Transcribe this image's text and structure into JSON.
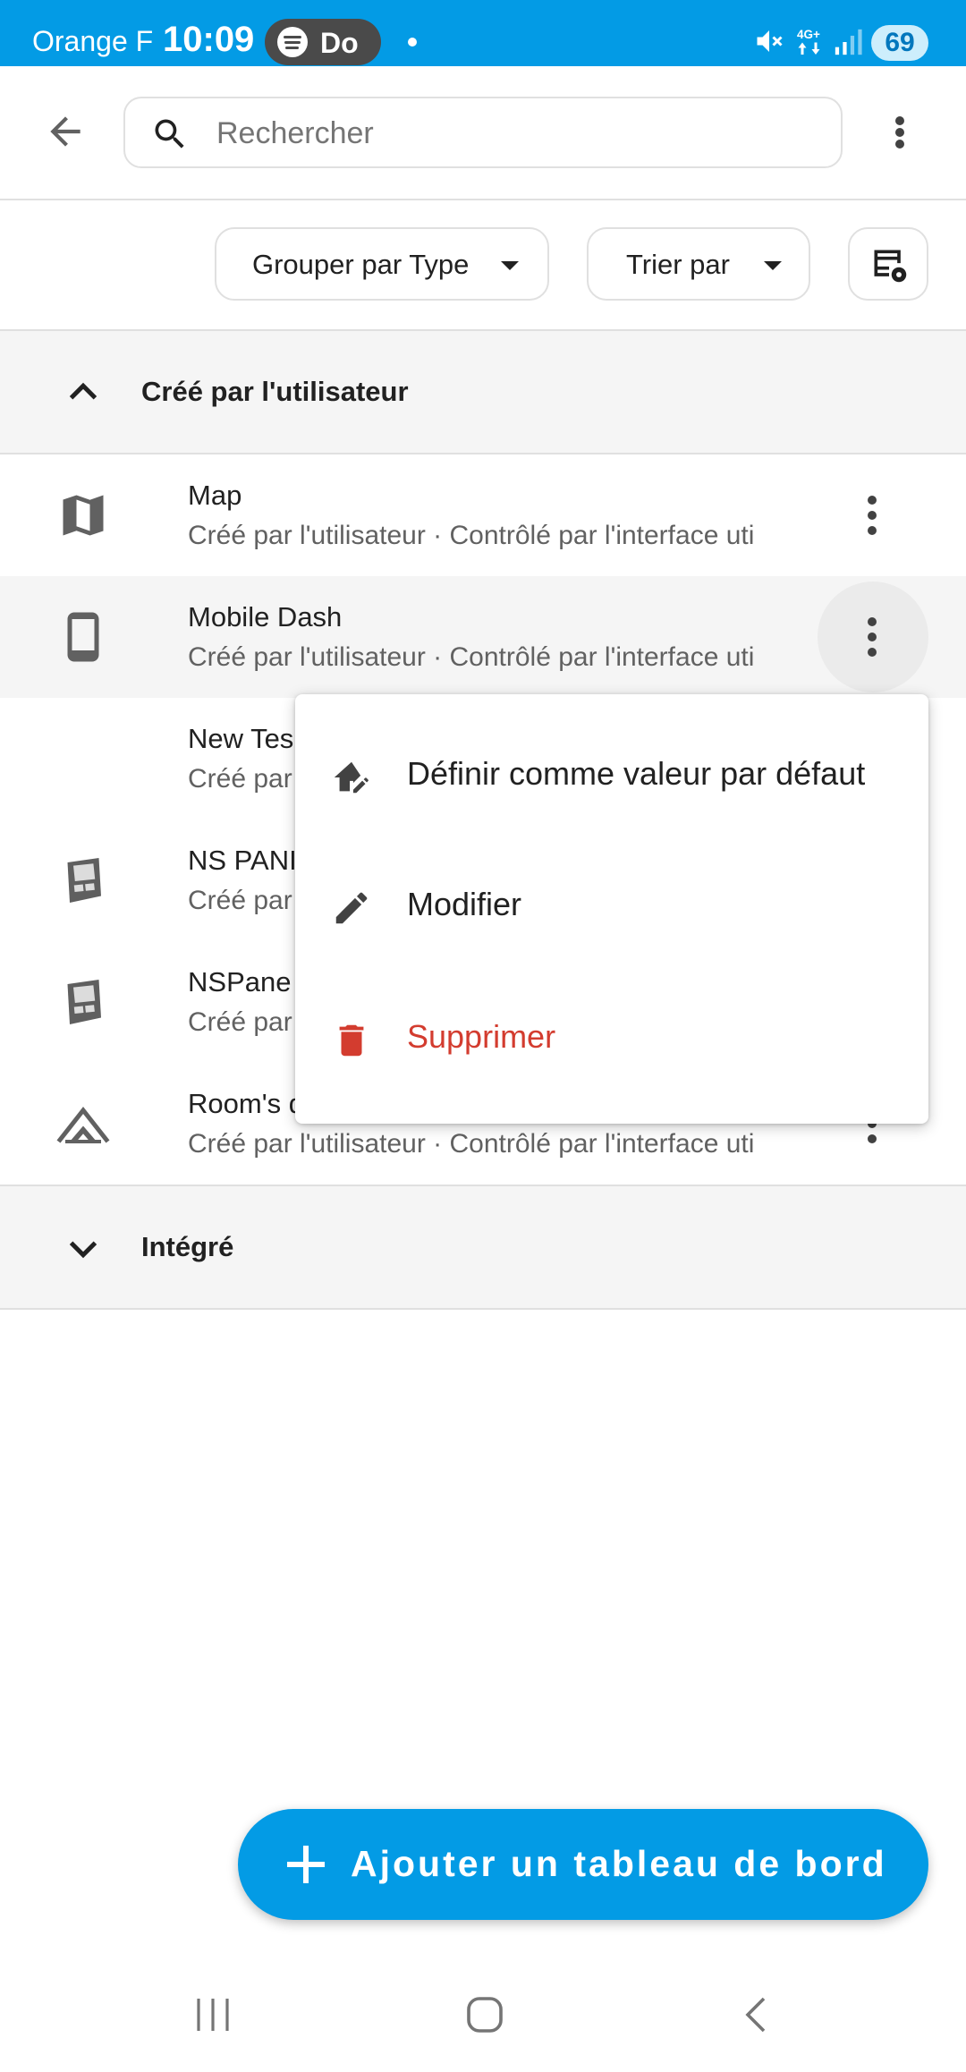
{
  "status_bar": {
    "carrier": "Orange F",
    "time": "10:09",
    "media_text": "Do",
    "battery": "69",
    "icons": [
      "spotify-icon",
      "mute-icon",
      "4g-icon",
      "signal-icon",
      "battery-icon"
    ]
  },
  "app_bar": {
    "search": {
      "placeholder": "Rechercher"
    },
    "icons": [
      "back-arrow-icon",
      "search-icon",
      "more-vert-icon"
    ]
  },
  "filters": {
    "group_by_label": "Grouper par Type",
    "sort_label": "Trier par",
    "settings_icon": "table-settings-icon"
  },
  "groups": [
    {
      "label": "Créé par l'utilisateur",
      "expanded": true
    },
    {
      "label": "Intégré",
      "expanded": false
    }
  ],
  "dashboards": [
    {
      "title": "Map",
      "subtitle": "Créé par l'utilisateur · Contrôlé par l'interface uti",
      "icon": "map-icon"
    },
    {
      "title": "Mobile Dash",
      "subtitle": "Créé par l'utilisateur · Contrôlé par l'interface uti",
      "icon": "phone-icon"
    },
    {
      "title": "New Tes",
      "subtitle": "Créé par",
      "icon": ""
    },
    {
      "title": "NS PANI",
      "subtitle": "Créé par",
      "icon": "ns-panel-icon"
    },
    {
      "title": "NSPane",
      "subtitle": "Créé par",
      "icon": "ns-panel-icon"
    },
    {
      "title": "Room's d",
      "subtitle": "Créé par l'utilisateur · Contrôlé par l'interface uti",
      "icon": "home-roof-icon"
    }
  ],
  "context_menu": {
    "items": [
      {
        "label": "Définir comme valeur par défaut",
        "icon": "home-edit-icon",
        "color": "#212121"
      },
      {
        "label": "Modifier",
        "icon": "pencil-icon",
        "color": "#212121"
      },
      {
        "label": "Supprimer",
        "icon": "delete-icon",
        "color": "#d33c2f"
      }
    ]
  },
  "fab": {
    "label": "Ajouter un tableau de bord",
    "icon": "plus-icon"
  },
  "colors": {
    "accent": "#039be5",
    "danger": "#d33c2f"
  }
}
